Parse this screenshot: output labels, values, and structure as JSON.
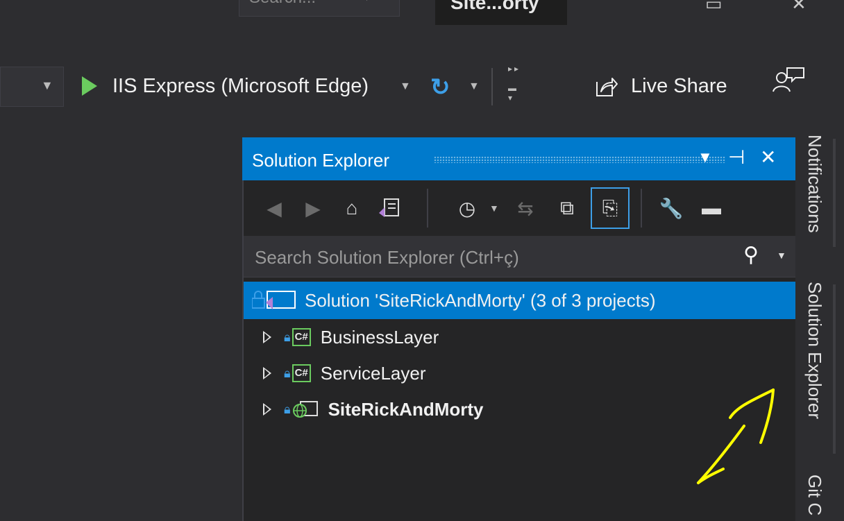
{
  "titlebar": {
    "search_text": "Search...",
    "window_tab": "Site...orty"
  },
  "toolbar": {
    "run_target": "IIS Express (Microsoft Edge)",
    "live_share": "Live Share"
  },
  "solution_explorer": {
    "title": "Solution Explorer",
    "search_placeholder": "Search Solution Explorer (Ctrl+ç)",
    "solution_label": "Solution 'SiteRickAndMorty' (3 of 3 projects)",
    "projects": [
      {
        "name": "BusinessLayer",
        "type": "csharp"
      },
      {
        "name": "ServiceLayer",
        "type": "csharp"
      },
      {
        "name": "SiteRickAndMorty",
        "type": "web"
      }
    ]
  },
  "side_tabs": {
    "notifications": "Notifications",
    "solution_explorer": "Solution Explorer",
    "git": "Git C"
  },
  "icons": {
    "csharp": "C#"
  },
  "colors": {
    "accent": "#007acc",
    "run_green": "#6bcb5f",
    "annotation": "#ffff00"
  }
}
